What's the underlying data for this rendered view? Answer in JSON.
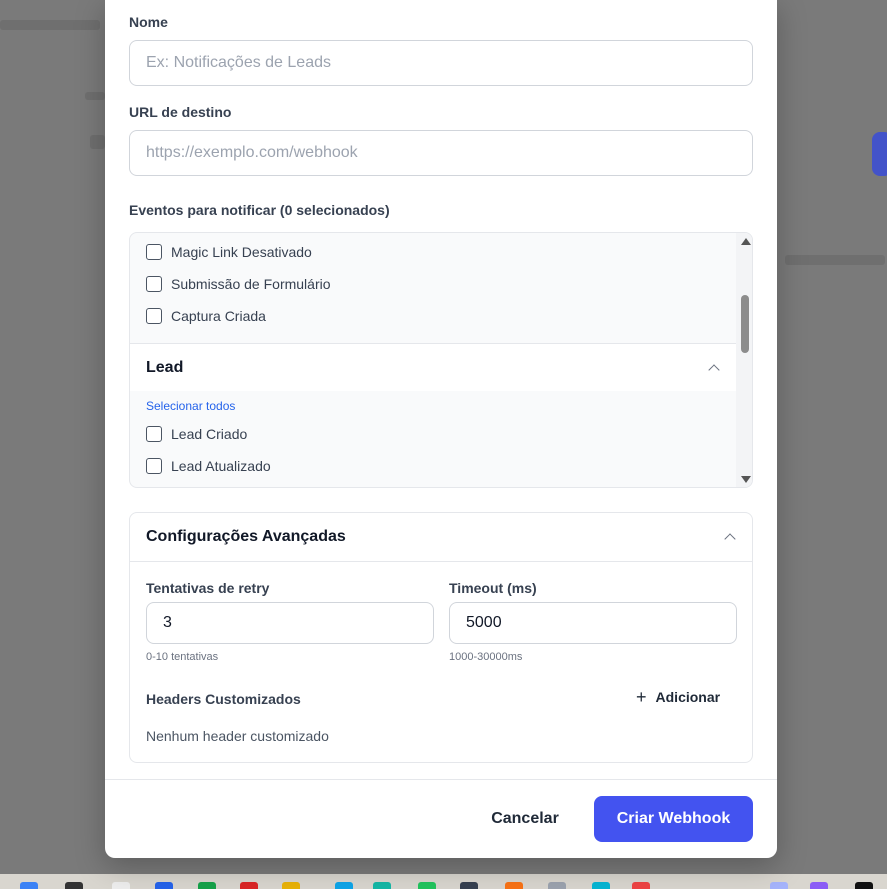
{
  "form": {
    "name_label": "Nome",
    "name_placeholder": "Ex: Notificações de Leads",
    "url_label": "URL de destino",
    "url_placeholder": "https://exemplo.com/webhook",
    "events_label": "Eventos para notificar (0 selecionados)"
  },
  "events": {
    "items_top": [
      "Magic Link Desativado",
      "Submissão de Formulário",
      "Captura Criada"
    ],
    "group_lead": {
      "title": "Lead",
      "select_all": "Selecionar todos",
      "items": [
        "Lead Criado",
        "Lead Atualizado"
      ]
    }
  },
  "advanced": {
    "title": "Configurações Avançadas",
    "retry_label": "Tentativas de retry",
    "retry_value": "3",
    "retry_hint": "0-10 tentativas",
    "timeout_label": "Timeout (ms)",
    "timeout_value": "5000",
    "timeout_hint": "1000-30000ms",
    "headers_label": "Headers Customizados",
    "add_label": "Adicionar",
    "no_headers": "Nenhum header customizado"
  },
  "footer": {
    "cancel": "Cancelar",
    "create": "Criar Webhook"
  },
  "colors": {
    "primary": "#4353f0",
    "link": "#2563eb"
  }
}
